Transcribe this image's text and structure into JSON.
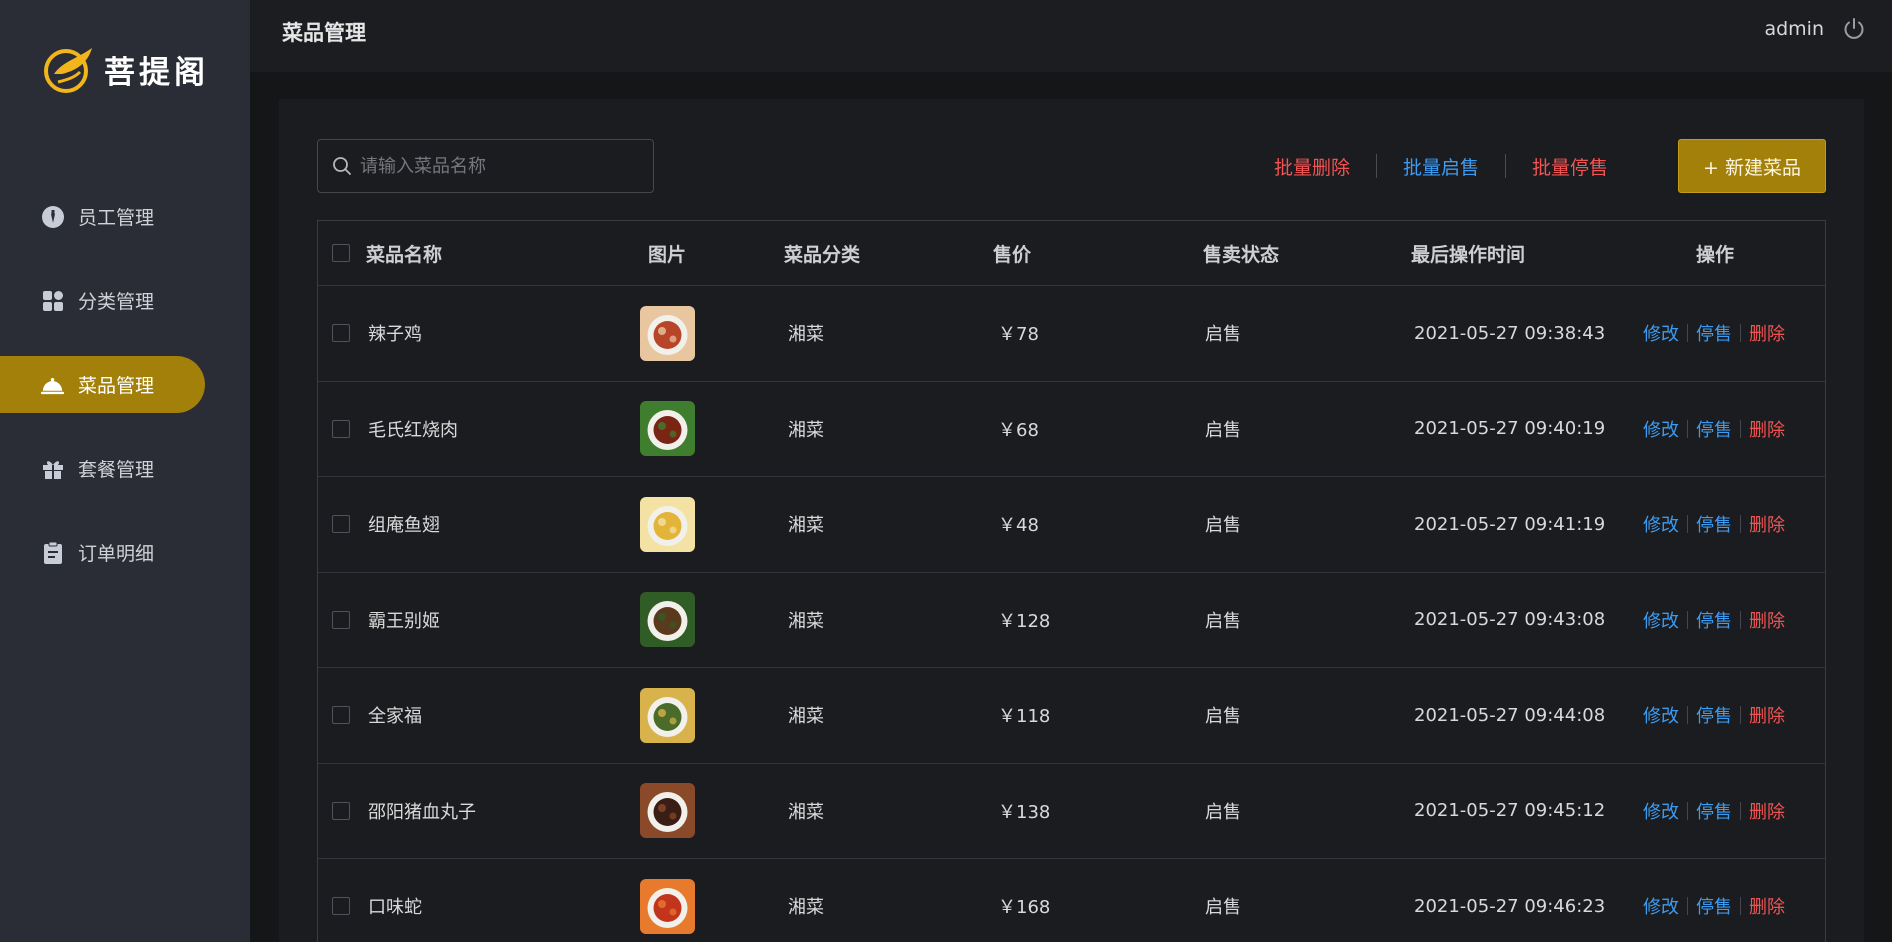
{
  "brand": {
    "name": "菩提阁",
    "accent": "#a3800a"
  },
  "sidebar": {
    "items": [
      {
        "label": "员工管理",
        "icon": "employee-icon",
        "active": false
      },
      {
        "label": "分类管理",
        "icon": "category-icon",
        "active": false
      },
      {
        "label": "菜品管理",
        "icon": "dish-cloche-icon",
        "active": true
      },
      {
        "label": "套餐管理",
        "icon": "gift-icon",
        "active": false
      },
      {
        "label": "订单明细",
        "icon": "clipboard-icon",
        "active": false
      }
    ]
  },
  "header": {
    "title": "菜品管理",
    "user": "admin"
  },
  "toolbar": {
    "search_placeholder": "请输入菜品名称",
    "batch_delete": "批量删除",
    "batch_enable": "批量启售",
    "batch_disable": "批量停售",
    "new_dish": "+ 新建菜品"
  },
  "table": {
    "headers": [
      "菜品名称",
      "图片",
      "菜品分类",
      "售价",
      "售卖状态",
      "最后操作时间",
      "操作"
    ],
    "ops": {
      "edit": "修改",
      "disable": "停售",
      "delete": "删除"
    },
    "rows": [
      {
        "name": "辣子鸡",
        "category": "湘菜",
        "price": "￥78",
        "status": "启售",
        "time": "2021-05-27 09:38:43",
        "img_colors": [
          "#b8452a",
          "#e8c7a0"
        ]
      },
      {
        "name": "毛氏红烧肉",
        "category": "湘菜",
        "price": "￥68",
        "status": "启售",
        "time": "2021-05-27 09:40:19",
        "img_colors": [
          "#7a2414",
          "#3f7d2f"
        ]
      },
      {
        "name": "组庵鱼翅",
        "category": "湘菜",
        "price": "￥48",
        "status": "启售",
        "time": "2021-05-27 09:41:19",
        "img_colors": [
          "#e2b43a",
          "#f3e2a4"
        ]
      },
      {
        "name": "霸王别姬",
        "category": "湘菜",
        "price": "￥128",
        "status": "启售",
        "time": "2021-05-27 09:43:08",
        "img_colors": [
          "#5a3a1c",
          "#2f5d25"
        ]
      },
      {
        "name": "全家福",
        "category": "湘菜",
        "price": "￥118",
        "status": "启售",
        "time": "2021-05-27 09:44:08",
        "img_colors": [
          "#4b6b2a",
          "#d8b24a"
        ]
      },
      {
        "name": "邵阳猪血丸子",
        "category": "湘菜",
        "price": "￥138",
        "status": "启售",
        "time": "2021-05-27 09:45:12",
        "img_colors": [
          "#3a1d15",
          "#8a4a2a"
        ]
      },
      {
        "name": "口味蛇",
        "category": "湘菜",
        "price": "￥168",
        "status": "启售",
        "time": "2021-05-27 09:46:23",
        "img_colors": [
          "#c2341c",
          "#e87a2e"
        ]
      }
    ]
  }
}
